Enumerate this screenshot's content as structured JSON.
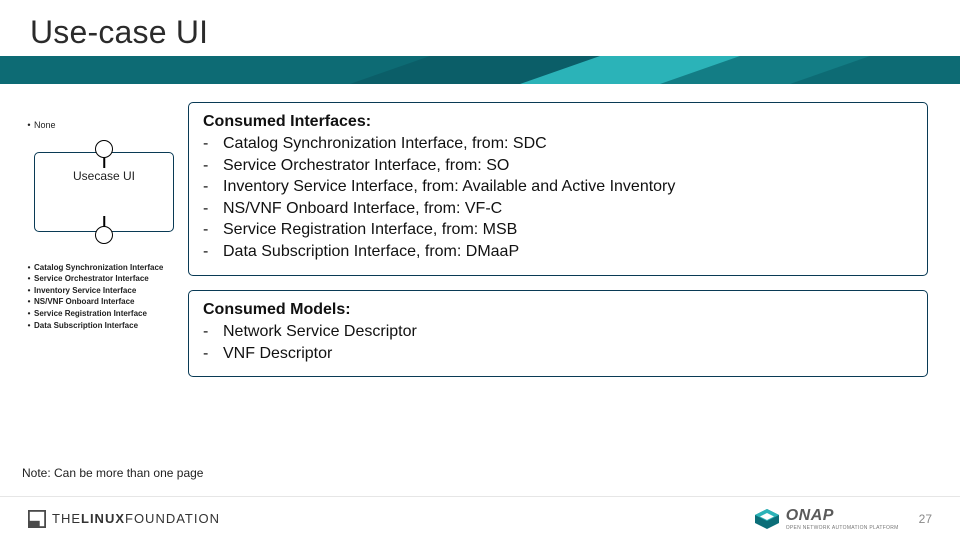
{
  "title": "Use-case UI",
  "left": {
    "top_bullet": "None",
    "component_label": "Usecase UI",
    "lower_bullets": [
      "Catalog Synchronization Interface",
      "Service Orchestrator Interface",
      "Inventory Service Interface",
      "NS/VNF Onboard Interface",
      "Service Registration Interface",
      "Data Subscription Interface"
    ]
  },
  "consumed_interfaces": {
    "header": "Consumed Interfaces:",
    "items": [
      "Catalog Synchronization Interface, from: SDC",
      "Service Orchestrator Interface, from: SO",
      "Inventory Service Interface, from: Available and Active Inventory",
      "NS/VNF Onboard Interface, from: VF-C",
      "Service Registration Interface, from: MSB",
      "Data Subscription Interface, from: DMaaP"
    ]
  },
  "consumed_models": {
    "header": "Consumed Models:",
    "items": [
      "Network Service Descriptor",
      "VNF Descriptor"
    ]
  },
  "note": "Note: Can be more than one page",
  "footer": {
    "linux_the": "THE",
    "linux_name": "LINUX",
    "linux_suffix": "FOUNDATION",
    "onap": "ONAP",
    "onap_sub": "OPEN NETWORK AUTOMATION PLATFORM",
    "page": "27"
  }
}
